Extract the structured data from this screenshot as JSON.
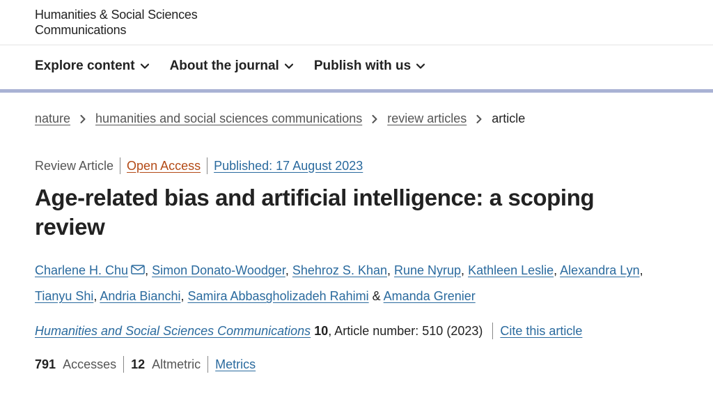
{
  "header": {
    "logo_line1": "Humanities & Social Sciences",
    "logo_line2": "Communications"
  },
  "nav": {
    "items": [
      {
        "label": "Explore content",
        "icon": "chevron-down-icon"
      },
      {
        "label": "About the journal",
        "icon": "chevron-down-icon"
      },
      {
        "label": "Publish with us",
        "icon": "chevron-down-icon"
      }
    ]
  },
  "breadcrumb": {
    "items": [
      "nature",
      "humanities and social sciences communications",
      "review articles"
    ],
    "current": "article"
  },
  "article": {
    "type": "Review Article",
    "access": "Open Access",
    "published": "Published: 17 August 2023",
    "title": "Age-related bias and artificial intelligence: a scoping review",
    "authors": [
      "Charlene H. Chu",
      "Simon Donato-Woodger",
      "Shehroz S. Khan",
      "Rune Nyrup",
      "Kathleen Leslie",
      "Alexandra Lyn",
      "Tianyu Shi",
      "Andria Bianchi",
      "Samira Abbasgholizadeh Rahimi",
      "Amanda Grenier"
    ],
    "author_sep": ", ",
    "author_last_sep": " & ",
    "journal": "Humanities and Social Sciences Communications",
    "volume": "10",
    "article_info": ", Article number: 510 (2023)",
    "cite_label": "Cite this article",
    "accesses_count": "791",
    "accesses_label": "Accesses",
    "altmetric_count": "12",
    "altmetric_label": "Altmetric",
    "metrics_label": "Metrics"
  },
  "colors": {
    "link": "#2a6a9e",
    "open_access": "#b34a16",
    "nav_bar": "#a9b2d4"
  }
}
